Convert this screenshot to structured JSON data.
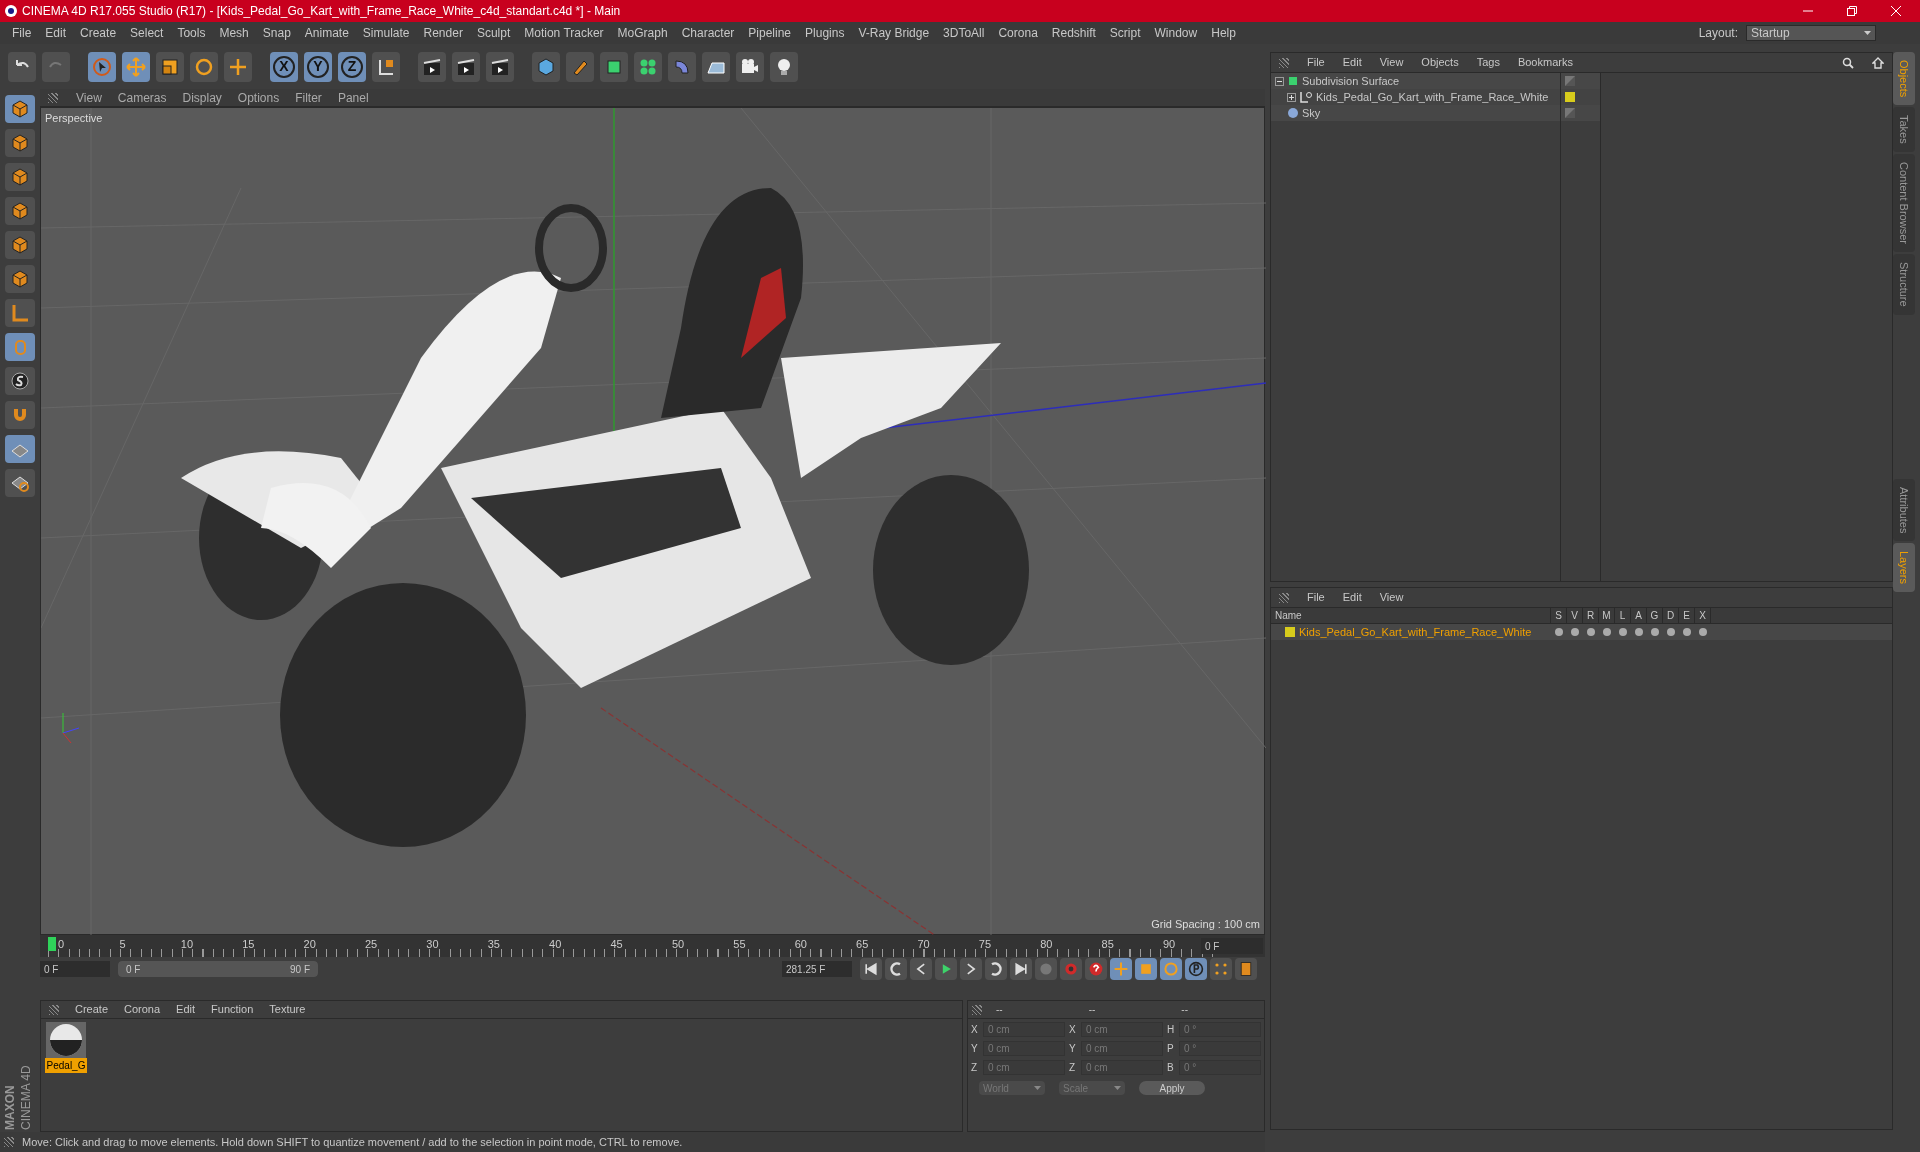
{
  "window": {
    "title": "CINEMA 4D R17.055 Studio (R17) - [Kids_Pedal_Go_Kart_with_Frame_Race_White_c4d_standart.c4d *] - Main"
  },
  "menu": [
    "File",
    "Edit",
    "Create",
    "Select",
    "Tools",
    "Mesh",
    "Snap",
    "Animate",
    "Simulate",
    "Render",
    "Sculpt",
    "Motion Tracker",
    "MoGraph",
    "Character",
    "Pipeline",
    "Plugins",
    "V-Ray Bridge",
    "3DToAll",
    "Corona",
    "Redshift",
    "Script",
    "Window",
    "Help"
  ],
  "layout": {
    "label": "Layout:",
    "value": "Startup"
  },
  "axis_buttons": [
    "X",
    "Y",
    "Z"
  ],
  "viewport": {
    "menu": [
      "View",
      "Cameras",
      "Display",
      "Options",
      "Filter",
      "Panel"
    ],
    "camera": "Perspective",
    "grid_spacing": "Grid Spacing : 100 cm"
  },
  "object_manager": {
    "menu": [
      "File",
      "Edit",
      "View",
      "Objects",
      "Tags",
      "Bookmarks"
    ],
    "objects": [
      {
        "name": "Subdivision Surface",
        "kind": "subdivision",
        "expanded": true,
        "children": [
          {
            "name": "Kids_Pedal_Go_Kart_with_Frame_Race_White",
            "kind": "null",
            "expanded": false,
            "color": "#d8cc1c"
          }
        ]
      },
      {
        "name": "Sky",
        "kind": "sky"
      }
    ]
  },
  "layer_manager": {
    "menu": [
      "File",
      "Edit",
      "View"
    ],
    "columns": [
      "Name",
      "S",
      "V",
      "R",
      "M",
      "L",
      "A",
      "G",
      "D",
      "E",
      "X"
    ],
    "layers": [
      {
        "name": "Kids_Pedal_Go_Kart_with_Frame_Race_White",
        "color": "#d8cc1c"
      }
    ]
  },
  "side_tabs_top": [
    {
      "label": "Objects",
      "selected": true
    },
    {
      "label": "Takes",
      "selected": false
    },
    {
      "label": "Content Browser",
      "selected": false
    },
    {
      "label": "Structure",
      "selected": false
    }
  ],
  "side_tabs_bottom": [
    {
      "label": "Attributes",
      "selected": false
    },
    {
      "label": "Layers",
      "selected": true
    }
  ],
  "timeline": {
    "ticks": [
      "0",
      "5",
      "10",
      "15",
      "20",
      "25",
      "30",
      "35",
      "40",
      "45",
      "50",
      "55",
      "60",
      "65",
      "70",
      "75",
      "80",
      "85",
      "90"
    ],
    "current_frame": "0 F",
    "start_frame": "0 F",
    "range": {
      "start": "0 F",
      "end": "90 F",
      "level": 1
    },
    "fps_field": "281.25 F"
  },
  "material_manager": {
    "menu": [
      "Create",
      "Corona",
      "Edit",
      "Function",
      "Texture"
    ],
    "materials": [
      {
        "name": "Pedal_G",
        "selected": true
      }
    ]
  },
  "coordinates": {
    "headers": [
      "--",
      "--",
      "--"
    ],
    "rows": [
      {
        "label_1": "X",
        "value_1": "0 cm",
        "label_2": "X",
        "value_2": "0 cm",
        "label_3": "H",
        "value_3": "0 °"
      },
      {
        "label_1": "Y",
        "value_1": "0 cm",
        "label_2": "Y",
        "value_2": "0 cm",
        "label_3": "P",
        "value_3": "0 °"
      },
      {
        "label_1": "Z",
        "value_1": "0 cm",
        "label_2": "Z",
        "value_2": "0 cm",
        "label_3": "B",
        "value_3": "0 °"
      }
    ],
    "mode_dropdowns": [
      "World",
      "Scale"
    ],
    "apply": "Apply"
  },
  "brand": {
    "line_1": "MAXON",
    "line_2": "CINEMA 4D"
  },
  "status_bar": "Move: Click and drag to move elements. Hold down SHIFT to quantize movement / add to the selection in point mode, CTRL to remove."
}
